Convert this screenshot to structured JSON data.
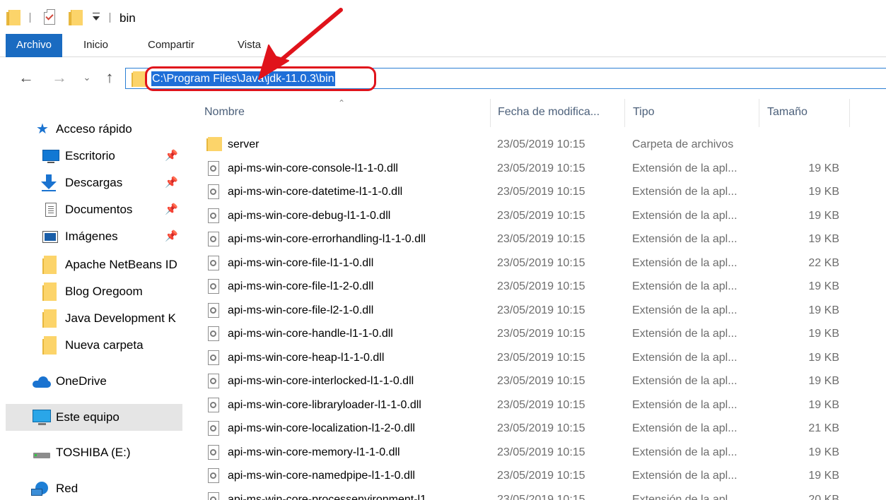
{
  "window": {
    "title": "bin"
  },
  "ribbon": {
    "tabs": [
      "Archivo",
      "Inicio",
      "Compartir",
      "Vista"
    ]
  },
  "address": {
    "path": "C:\\Program Files\\Java\\jdk-11.0.3\\bin"
  },
  "sidebar": {
    "quick_access": "Acceso rápido",
    "items": [
      {
        "label": "Escritorio",
        "icon": "desktop-icon",
        "pinned": true
      },
      {
        "label": "Descargas",
        "icon": "download-icon",
        "pinned": true
      },
      {
        "label": "Documentos",
        "icon": "document-icon",
        "pinned": true
      },
      {
        "label": "Imágenes",
        "icon": "image-icon",
        "pinned": true
      },
      {
        "label": "Apache NetBeans ID",
        "icon": "folder-icon",
        "pinned": false
      },
      {
        "label": "Blog Oregoom",
        "icon": "folder-icon",
        "pinned": false
      },
      {
        "label": "Java Development K",
        "icon": "folder-icon",
        "pinned": false
      },
      {
        "label": "Nueva carpeta",
        "icon": "folder-icon",
        "pinned": false
      }
    ],
    "onedrive": "OneDrive",
    "this_pc": "Este equipo",
    "drive": "TOSHIBA (E:)",
    "network": "Red"
  },
  "columns": {
    "name": "Nombre",
    "date": "Fecha de modifica...",
    "type": "Tipo",
    "size": "Tamaño"
  },
  "files": [
    {
      "name": "server",
      "date": "23/05/2019 10:15",
      "type": "Carpeta de archivos",
      "size": "",
      "kind": "folder"
    },
    {
      "name": "api-ms-win-core-console-l1-1-0.dll",
      "date": "23/05/2019 10:15",
      "type": "Extensión de la apl...",
      "size": "19 KB",
      "kind": "dll"
    },
    {
      "name": "api-ms-win-core-datetime-l1-1-0.dll",
      "date": "23/05/2019 10:15",
      "type": "Extensión de la apl...",
      "size": "19 KB",
      "kind": "dll"
    },
    {
      "name": "api-ms-win-core-debug-l1-1-0.dll",
      "date": "23/05/2019 10:15",
      "type": "Extensión de la apl...",
      "size": "19 KB",
      "kind": "dll"
    },
    {
      "name": "api-ms-win-core-errorhandling-l1-1-0.dll",
      "date": "23/05/2019 10:15",
      "type": "Extensión de la apl...",
      "size": "19 KB",
      "kind": "dll"
    },
    {
      "name": "api-ms-win-core-file-l1-1-0.dll",
      "date": "23/05/2019 10:15",
      "type": "Extensión de la apl...",
      "size": "22 KB",
      "kind": "dll"
    },
    {
      "name": "api-ms-win-core-file-l1-2-0.dll",
      "date": "23/05/2019 10:15",
      "type": "Extensión de la apl...",
      "size": "19 KB",
      "kind": "dll"
    },
    {
      "name": "api-ms-win-core-file-l2-1-0.dll",
      "date": "23/05/2019 10:15",
      "type": "Extensión de la apl...",
      "size": "19 KB",
      "kind": "dll"
    },
    {
      "name": "api-ms-win-core-handle-l1-1-0.dll",
      "date": "23/05/2019 10:15",
      "type": "Extensión de la apl...",
      "size": "19 KB",
      "kind": "dll"
    },
    {
      "name": "api-ms-win-core-heap-l1-1-0.dll",
      "date": "23/05/2019 10:15",
      "type": "Extensión de la apl...",
      "size": "19 KB",
      "kind": "dll"
    },
    {
      "name": "api-ms-win-core-interlocked-l1-1-0.dll",
      "date": "23/05/2019 10:15",
      "type": "Extensión de la apl...",
      "size": "19 KB",
      "kind": "dll"
    },
    {
      "name": "api-ms-win-core-libraryloader-l1-1-0.dll",
      "date": "23/05/2019 10:15",
      "type": "Extensión de la apl...",
      "size": "19 KB",
      "kind": "dll"
    },
    {
      "name": "api-ms-win-core-localization-l1-2-0.dll",
      "date": "23/05/2019 10:15",
      "type": "Extensión de la apl...",
      "size": "21 KB",
      "kind": "dll"
    },
    {
      "name": "api-ms-win-core-memory-l1-1-0.dll",
      "date": "23/05/2019 10:15",
      "type": "Extensión de la apl...",
      "size": "19 KB",
      "kind": "dll"
    },
    {
      "name": "api-ms-win-core-namedpipe-l1-1-0.dll",
      "date": "23/05/2019 10:15",
      "type": "Extensión de la apl...",
      "size": "19 KB",
      "kind": "dll"
    },
    {
      "name": "api-ms-win-core-processenvironment-l1",
      "date": "23/05/2019 10:15",
      "type": "Extensión de la apl...",
      "size": "20 KB",
      "kind": "dll"
    }
  ],
  "colors": {
    "accent": "#1a6bc1",
    "selection": "#1f6fd8",
    "annotation": "#e0131b",
    "folder": "#fcd46a"
  }
}
